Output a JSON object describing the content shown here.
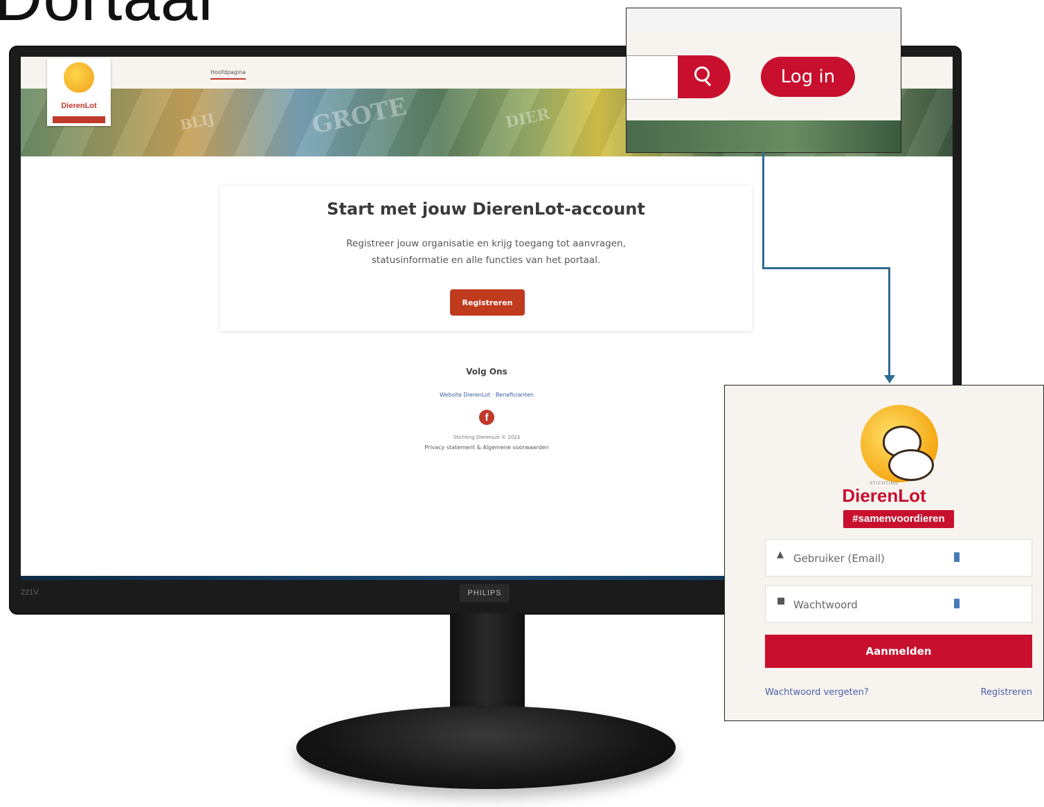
{
  "heading_fragment": "Dortaal",
  "monitor": {
    "model": "221V",
    "brand": "PHILIPS"
  },
  "site": {
    "nav": {
      "home": "Hoofdpagina"
    },
    "logo": {
      "name": "DierenLot"
    },
    "card": {
      "title": "Start met jouw DierenLot-account",
      "description": "Registreer jouw organisatie en krijg toegang tot aanvragen, statusinformatie en alle functies van het portaal.",
      "button": "Registreren"
    },
    "footer": {
      "follow": "Volg Ons",
      "links": "Website DierenLot · Beneficianten",
      "facebook_glyph": "f",
      "copyright": "Stichting DierenLot © 2023",
      "privacy": "Privacy statement & Algemene voorwaarden"
    },
    "colors": {
      "brand_red": "#c8102e",
      "button_red": "#c03a1e",
      "link_blue": "#4a5fa8"
    }
  },
  "zoom_header": {
    "login_button": "Log in",
    "search_icon": "search-icon"
  },
  "login_panel": {
    "stichting": "STICHTING",
    "brand": "DierenLot",
    "hashtag": "#samenvoordieren",
    "user_placeholder": "Gebruiker (Email)",
    "password_placeholder": "Wachtwoord",
    "submit": "Aanmelden",
    "forgot": "Wachtwoord vergeten?",
    "register": "Registreren",
    "user_icon": "user-icon",
    "lock_icon": "lock-icon"
  }
}
